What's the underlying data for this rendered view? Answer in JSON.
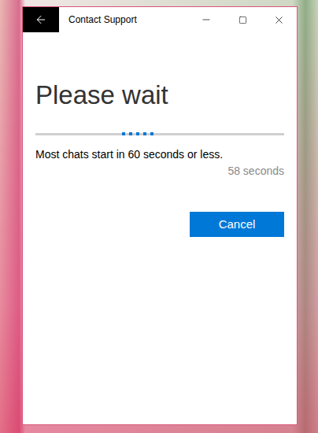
{
  "window": {
    "title": "Contact Support"
  },
  "heading": "Please wait",
  "progress": {
    "indeterminate": true
  },
  "message": "Most chats start in 60 seconds or less.",
  "countdown": "58 seconds",
  "buttons": [
    "Cancel"
  ]
}
